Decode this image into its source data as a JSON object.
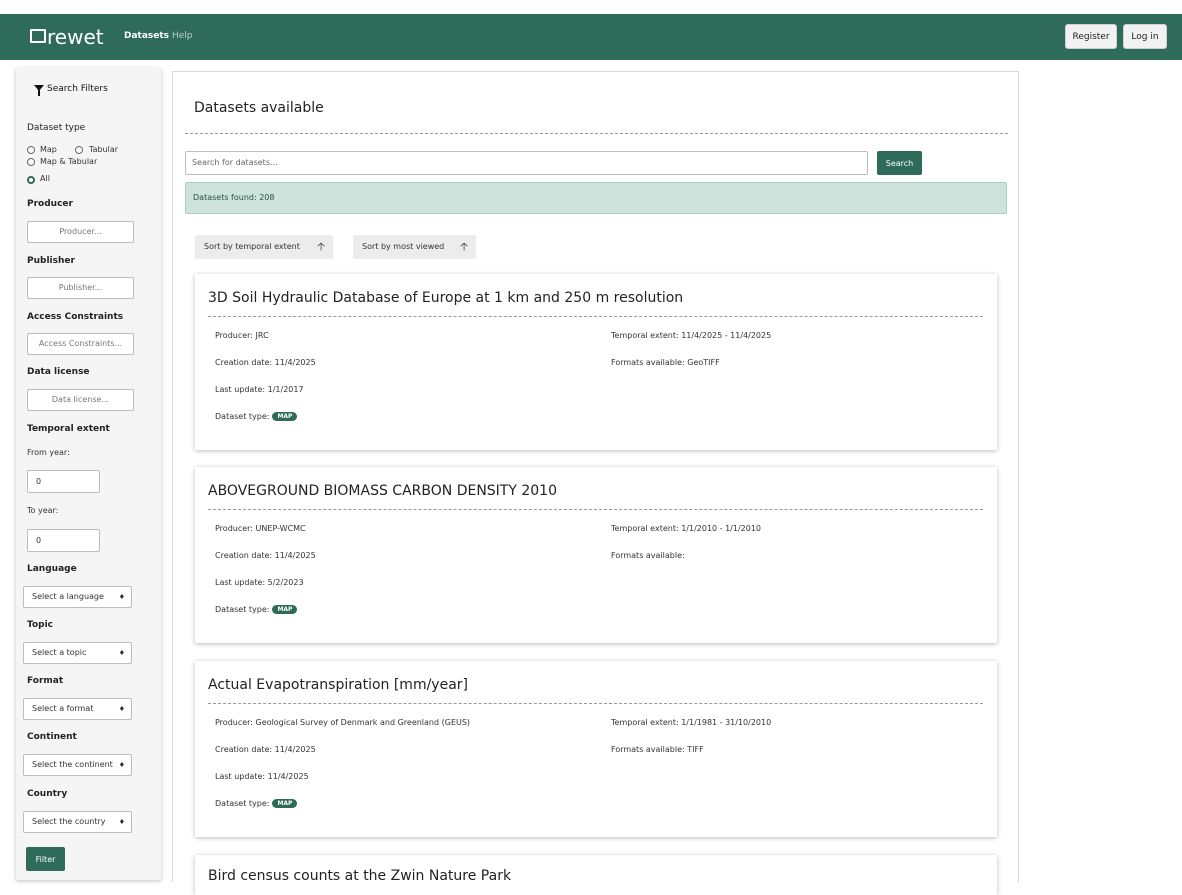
{
  "header": {
    "logo_text": "rewet",
    "nav": [
      "Datasets",
      "Help"
    ],
    "register_label": "Register",
    "login_label": "Log in"
  },
  "sidebar": {
    "title": "Search Filters",
    "dataset_type_label": "Dataset type",
    "dataset_type_options": [
      "Map",
      "Tabular",
      "Map & Tabular",
      "All"
    ],
    "dataset_type_selected": "All",
    "producer_label": "Producer",
    "producer_placeholder": "Producer...",
    "publisher_label": "Publisher",
    "publisher_placeholder": "Publisher...",
    "access_label": "Access Constraints",
    "access_placeholder": "Access Constraints...",
    "license_label": "Data license",
    "license_placeholder": "Data license...",
    "temporal_label": "Temporal extent",
    "from_label": "From year:",
    "from_value": "0",
    "to_label": "To year:",
    "to_value": "0",
    "language_label": "Language",
    "language_value": "Select a language",
    "topic_label": "Topic",
    "topic_value": "Select a topic",
    "format_label": "Format",
    "format_value": "Select a format",
    "continent_label": "Continent",
    "continent_value": "Select the continent",
    "country_label": "Country",
    "country_value": "Select the country",
    "filter_label": "Filter"
  },
  "main": {
    "title": "Datasets available",
    "search_placeholder": "Search for datasets...",
    "search_button": "Search",
    "found_text": "Datasets found: 208",
    "sort_temporal": "Sort by temporal extent",
    "sort_viewed": "Sort by most viewed",
    "datasets": [
      {
        "title": "3D Soil Hydraulic Database of Europe at 1 km and 250 m resolution",
        "producer": "Producer: JRC",
        "creation": "Creation date: 11/4/2025",
        "update": "Last update: 1/1/2017",
        "type_label": "Dataset type:",
        "type_badge": "MAP",
        "temporal": "Temporal extent: 11/4/2025 - 11/4/2025",
        "formats": "Formats available: GeoTIFF"
      },
      {
        "title": "ABOVEGROUND BIOMASS CARBON DENSITY 2010",
        "producer": "Producer: UNEP-WCMC",
        "creation": "Creation date: 11/4/2025",
        "update": "Last update: 5/2/2023",
        "type_label": "Dataset type:",
        "type_badge": "MAP",
        "temporal": "Temporal extent: 1/1/2010 - 1/1/2010",
        "formats": "Formats available:"
      },
      {
        "title": "Actual Evapotranspiration [mm/year]",
        "producer": "Producer: Geological Survey of Denmark and Greenland (GEUS)",
        "creation": "Creation date: 11/4/2025",
        "update": "Last update: 11/4/2025",
        "type_label": "Dataset type:",
        "type_badge": "MAP",
        "temporal": "Temporal extent: 1/1/1981 - 31/10/2010",
        "formats": "Formats available: TIFF"
      },
      {
        "title": "Bird census counts at the Zwin Nature Park"
      }
    ]
  }
}
